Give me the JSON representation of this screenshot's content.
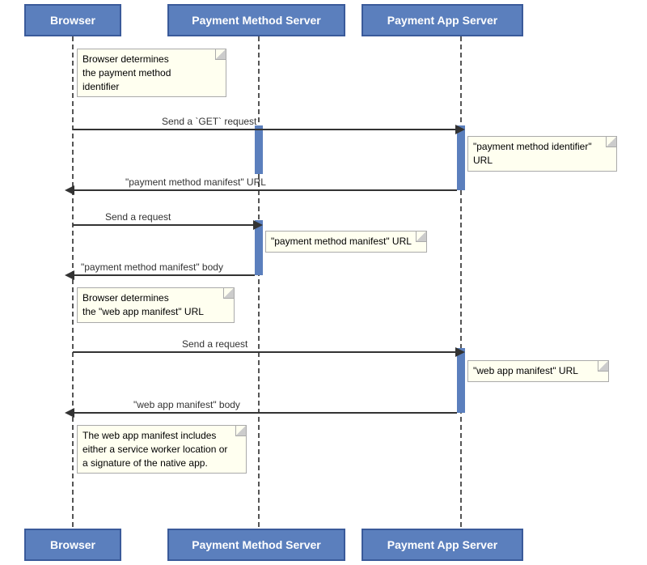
{
  "actors": {
    "browser": {
      "label": "Browser"
    },
    "payment_method_server": {
      "label": "Payment Method Server"
    },
    "payment_app_server": {
      "label": "Payment App Server"
    }
  },
  "notes": {
    "n1": {
      "text": "Browser determines\nthe payment method\nidentifier"
    },
    "n2": {
      "text": "\"payment method identifier\" URL"
    },
    "n3": {
      "text": "\"payment method manifest\" URL"
    },
    "n4": {
      "text": "Browser determines\nthe \"web app manifest\" URL"
    },
    "n5": {
      "text": "\"web app manifest\" URL"
    },
    "n6": {
      "text": "The web app manifest includes\neither a service worker location or\na signature of the native app."
    }
  },
  "arrows": {
    "a1_label": "Send a `GET` request",
    "a2_label": "\"payment method manifest\" URL",
    "a3_label": "Send a request",
    "a4_label": "\"payment method manifest\" body",
    "a5_label": "Send a request",
    "a6_label": "\"web app manifest\" body"
  }
}
